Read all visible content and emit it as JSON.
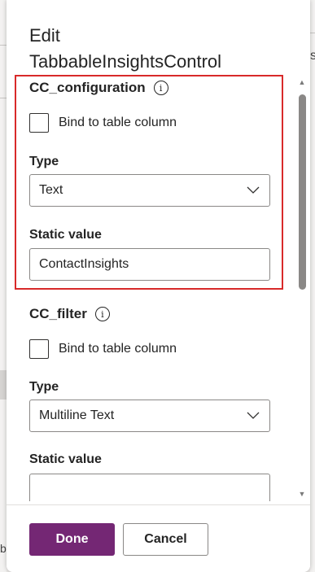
{
  "panel": {
    "title_line1": "Edit",
    "title_line2": "TabbableInsightsControl"
  },
  "sections": [
    {
      "title": "CC_configuration",
      "bind_label": "Bind to table column",
      "bind_checked": false,
      "type_label": "Type",
      "type_value": "Text",
      "static_label": "Static value",
      "static_value": "ContactInsights"
    },
    {
      "title": "CC_filter",
      "bind_label": "Bind to table column",
      "bind_checked": false,
      "type_label": "Type",
      "type_value": "Multiline Text",
      "static_label": "Static value",
      "static_value": ""
    }
  ],
  "footer": {
    "done_label": "Done",
    "cancel_label": "Cancel"
  },
  "background": {
    "left_glyph": "b",
    "right_glyph": "s"
  },
  "colors": {
    "primary": "#742774",
    "highlight": "#d82a2a"
  }
}
